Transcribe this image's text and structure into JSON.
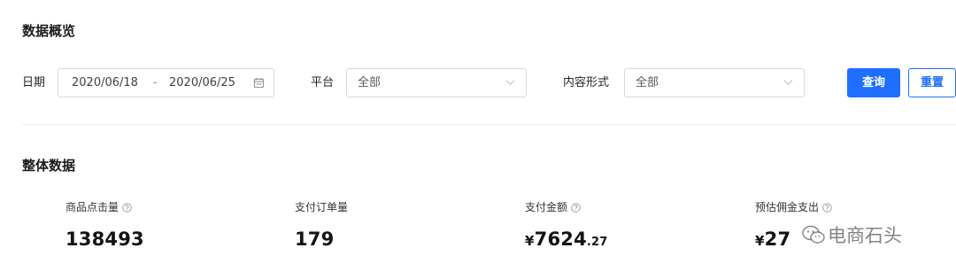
{
  "header": {
    "title": "数据概览"
  },
  "filters": {
    "date": {
      "label": "日期",
      "start": "2020/06/18",
      "separator": "-",
      "end": "2020/06/25"
    },
    "platform": {
      "label": "平台",
      "value": "全部"
    },
    "content_form": {
      "label": "内容形式",
      "value": "全部"
    },
    "query_button": "查询",
    "reset_button": "重置"
  },
  "overall": {
    "title": "整体数据",
    "metrics": [
      {
        "label": "商品点击量",
        "value": "138493",
        "has_help": true
      },
      {
        "label": "支付订单量",
        "value": "179",
        "has_help": false
      },
      {
        "label": "支付金额",
        "currency": "¥",
        "integer": "7624",
        "decimal": ".27",
        "has_help": true
      },
      {
        "label": "预估佣金支出",
        "currency": "¥",
        "integer": "27",
        "has_help": true
      }
    ]
  },
  "watermark": {
    "text": "电商石头",
    "icon": "wechat-icon"
  },
  "colors": {
    "primary": "#1e6fff",
    "border": "#d9d9d9",
    "divider": "#eeeeee"
  }
}
